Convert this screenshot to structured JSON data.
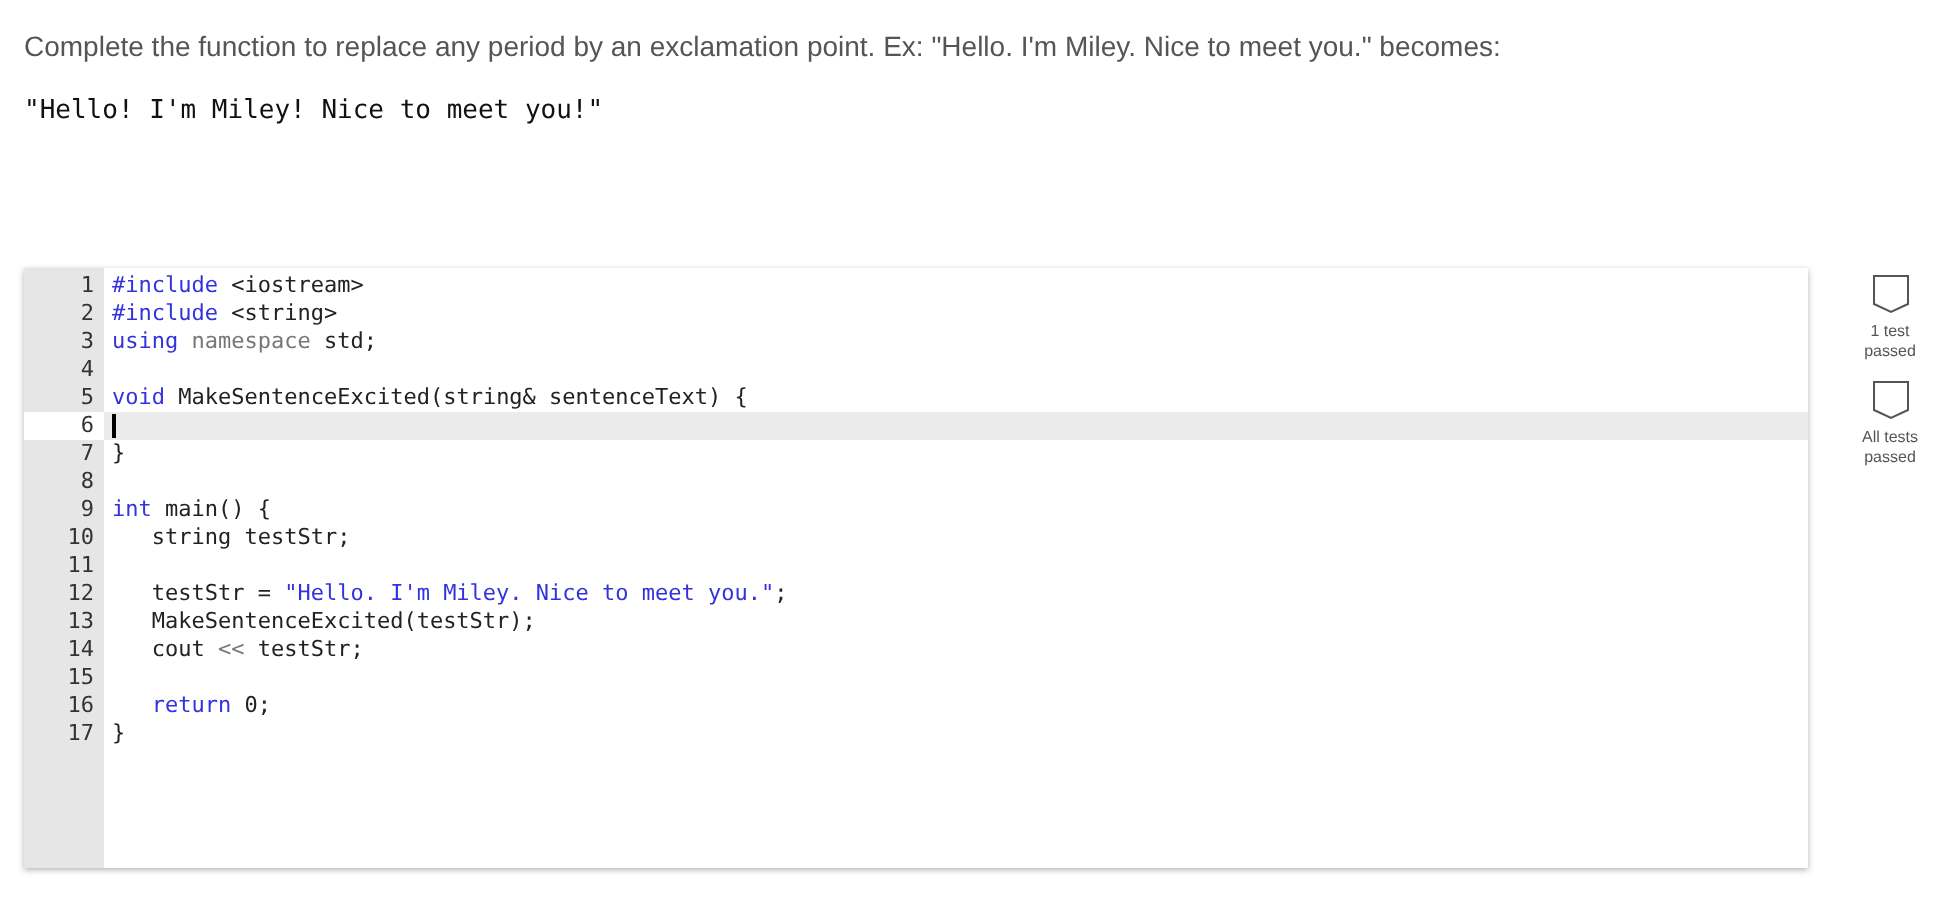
{
  "prompt": "Complete the function to replace any period by an exclamation point. Ex: \"Hello. I'm Miley. Nice to meet you.\" becomes:",
  "expected_output": "\"Hello! I'm Miley! Nice to meet you!\"",
  "editor": {
    "lines": [
      {
        "number": "1",
        "active": false,
        "tokens": [
          {
            "text": "#include",
            "kind": "keyword"
          },
          {
            "text": " <iostream>",
            "kind": "plain"
          }
        ]
      },
      {
        "number": "2",
        "active": false,
        "tokens": [
          {
            "text": "#include",
            "kind": "keyword"
          },
          {
            "text": " <string>",
            "kind": "plain"
          }
        ]
      },
      {
        "number": "3",
        "active": false,
        "tokens": [
          {
            "text": "using",
            "kind": "keyword"
          },
          {
            "text": " namespace",
            "kind": "muted"
          },
          {
            "text": " std;",
            "kind": "plain"
          }
        ]
      },
      {
        "number": "4",
        "active": false
      },
      {
        "number": "5",
        "active": false,
        "tokens": [
          {
            "text": "void",
            "kind": "keyword"
          },
          {
            "text": " MakeSentenceExcited(string& sentenceText) {",
            "kind": "plain"
          }
        ]
      },
      {
        "number": "6",
        "active": true
      },
      {
        "number": "7",
        "active": false,
        "tokens": [
          {
            "text": "}",
            "kind": "plain"
          }
        ]
      },
      {
        "number": "8",
        "active": false
      },
      {
        "number": "9",
        "active": false,
        "tokens": [
          {
            "text": "int",
            "kind": "keyword"
          },
          {
            "text": " main() {",
            "kind": "plain"
          }
        ]
      },
      {
        "number": "10",
        "active": false,
        "tokens": [
          {
            "text": "   string testStr;",
            "kind": "plain"
          }
        ]
      },
      {
        "number": "11",
        "active": false
      },
      {
        "number": "12",
        "active": false,
        "tokens": [
          {
            "text": "   testStr = ",
            "kind": "plain"
          },
          {
            "text": "\"Hello. I'm Miley. Nice to meet you.\"",
            "kind": "string"
          },
          {
            "text": ";",
            "kind": "plain"
          }
        ]
      },
      {
        "number": "13",
        "active": false,
        "tokens": [
          {
            "text": "   MakeSentenceExcited(testStr);",
            "kind": "plain"
          }
        ]
      },
      {
        "number": "14",
        "active": false,
        "tokens": [
          {
            "text": "   cout ",
            "kind": "plain"
          },
          {
            "text": "<<",
            "kind": "muted"
          },
          {
            "text": " testStr;",
            "kind": "plain"
          }
        ]
      },
      {
        "number": "15",
        "active": false
      },
      {
        "number": "16",
        "active": false,
        "tokens": [
          {
            "text": "   return",
            "kind": "keyword"
          },
          {
            "text": " 0;",
            "kind": "plain"
          }
        ]
      },
      {
        "number": "17",
        "active": false,
        "tokens": [
          {
            "text": "}",
            "kind": "plain"
          }
        ]
      }
    ]
  },
  "tests": [
    {
      "label": "1 test passed",
      "passed": false
    },
    {
      "label": "All tests passed",
      "passed": false
    }
  ]
}
